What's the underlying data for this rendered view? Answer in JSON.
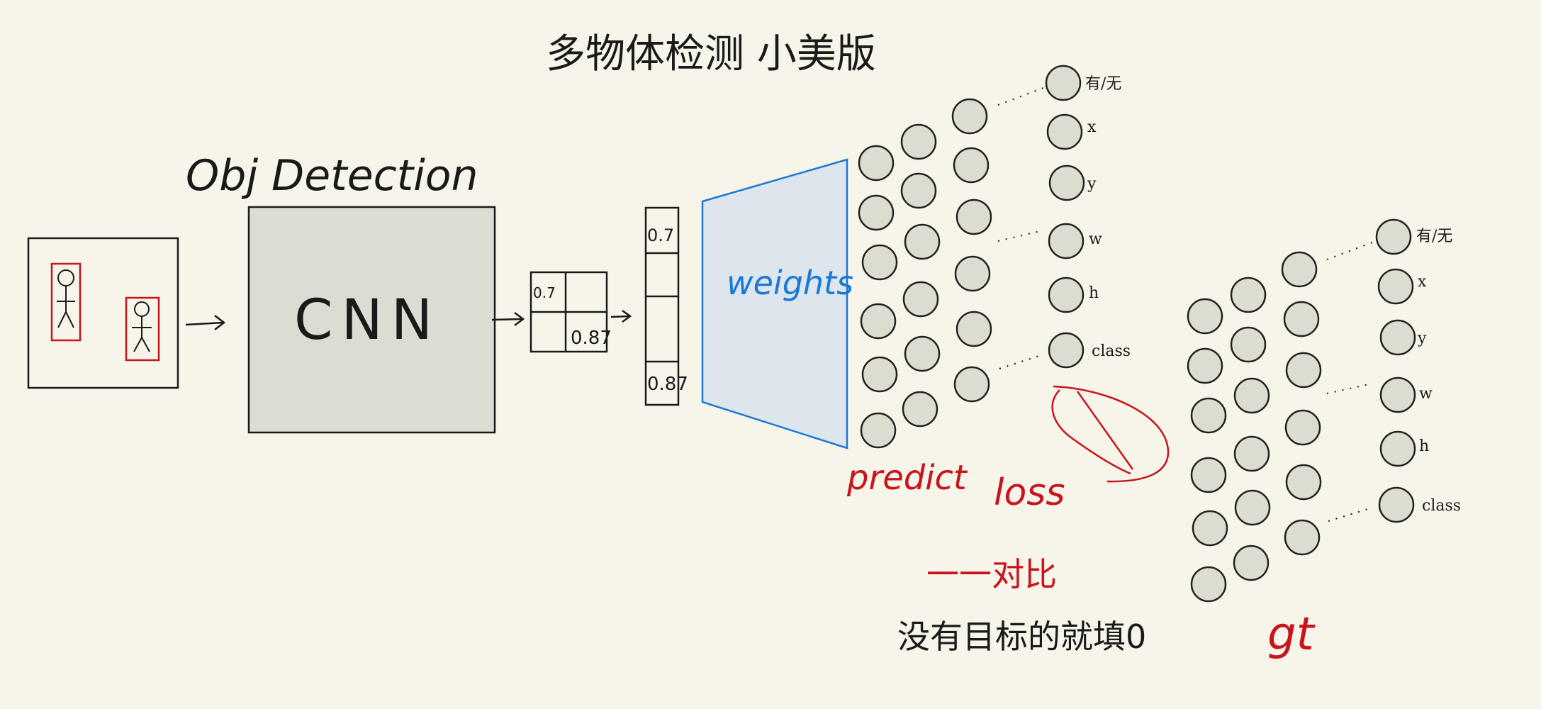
{
  "title": "多物体检测 小美版",
  "subtitle": "Obj  Detection",
  "cnn_label": "CNN",
  "weights_label": "weights",
  "grid_values": {
    "top_left": "0.7",
    "bottom_right": "0.87"
  },
  "vector_values": {
    "top": "0.7",
    "bottom": "0.87"
  },
  "predict_label": "predict",
  "loss_label": "loss",
  "compare_note": "一一对比",
  "fill_note": "没有目标的就填0",
  "gt_label": "gt",
  "output_labels": [
    "有/无",
    "x",
    "y",
    "w",
    "h",
    "class"
  ],
  "colors": {
    "background": "#f7f4e9",
    "ink": "#1a1a1a",
    "cnn_fill": "#dddcd2",
    "weights_stroke": "#1a78d6",
    "weights_fill": "#dde6ec",
    "red": "#c8141c",
    "node_fill": "#dddcd0"
  }
}
